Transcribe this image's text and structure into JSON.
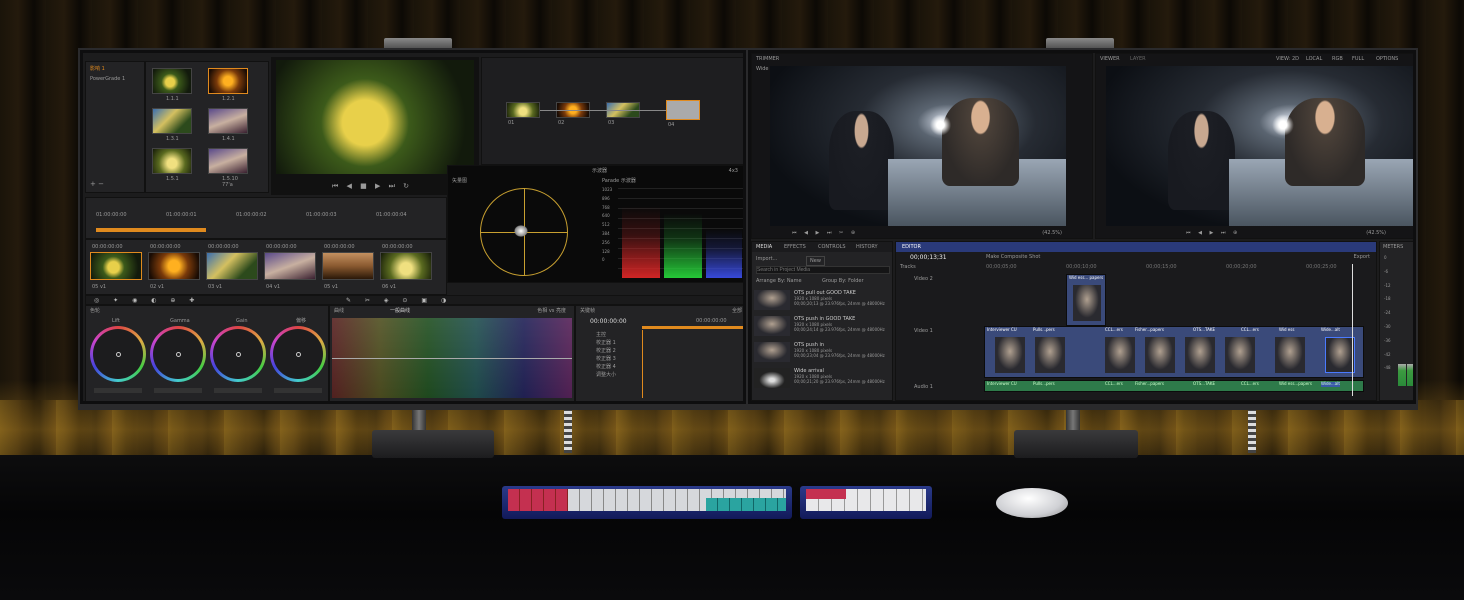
{
  "left_app": {
    "gallery": {
      "items": [
        {
          "label": "影响 1"
        },
        {
          "label": "PowerGrade 1"
        }
      ],
      "stills": [
        "1.1.1",
        "1.2.1",
        "1.3.1",
        "1.4.1",
        "1.5.1",
        "1.5.10\n77'a"
      ]
    },
    "timecodes": [
      "01:00:00:00",
      "01:00:00:01",
      "01:00:00:02",
      "01:00:00:03",
      "01:00:00:04"
    ],
    "clip_timecodes": [
      "00:00:00:00",
      "00:00:00:00",
      "00:00:00:00",
      "00:00:00:00",
      "00:00:00:00",
      "00:00:00:00"
    ],
    "clip_labels": [
      "05 v1",
      "02 v1",
      "03 v1",
      "04 v1",
      "05 v1",
      "06 v1"
    ],
    "nodes": [
      "01",
      "02",
      "03",
      "04"
    ],
    "scopes": {
      "title": "示波器",
      "vectorscope_label": "矢量图",
      "parade_label": "Parade 示波器",
      "zoom": "4x3",
      "levels": [
        "1023",
        "896",
        "768",
        "640",
        "512",
        "384",
        "256",
        "128",
        "0"
      ]
    },
    "color_panel": {
      "title": "色轮",
      "wheels": [
        {
          "name": "Lift"
        },
        {
          "name": "Gamma"
        },
        {
          "name": "Gain"
        },
        {
          "name": "偏移"
        }
      ],
      "curves_label": "曲线",
      "curves_mode": "一般曲线",
      "hue_label": "色相 vs 亮度",
      "keyframes_label": "关键帧",
      "keyframes_mode": "全部",
      "keyframe_time": "00:00:00:00",
      "keyframe_end": "00:00:00:00",
      "keyframe_tracks": [
        "主控",
        "校正器 1",
        "校正器 2",
        "校正器 3",
        "校正器 4",
        "调整大小"
      ]
    }
  },
  "right_app": {
    "panels": {
      "trimmer": "TRIMMER",
      "viewer": "VIEWER",
      "layer": "LAYER",
      "viewer_opts": [
        "VIEW: 2D",
        "LOCAL",
        "RGB",
        "FULL",
        "OPTIONS"
      ],
      "clip_name": "Wide papers alt",
      "zoom_left": "(42.5%)",
      "zoom_right": "(42.5%)"
    },
    "media": {
      "tabs": [
        "MEDIA",
        "EFFECTS",
        "CONTROLS",
        "HISTORY"
      ],
      "import_label": "Import...",
      "new_label": "New",
      "search_placeholder": "Search in Project Media",
      "arrange_label": "Arrange By: Name",
      "group_label": "Group By: Folder",
      "items": [
        {
          "name": "OTS pull out GOOD TAKE",
          "meta": "1920 x 1080 pixels\n00;00;20;13 @ 23.976fps, 24mm @ 48000Hz"
        },
        {
          "name": "OTS push in GOOD TAKE",
          "meta": "1920 x 1080 pixels\n00;00;24;14 @ 23.976fps, 24mm @ 48000Hz"
        },
        {
          "name": "OTS push in",
          "meta": "1920 x 1080 pixels\n00;00;23;04 @ 23.976fps, 24mm @ 48000Hz"
        },
        {
          "name": "Wide arrival",
          "meta": "1920 x 1080 pixels\n00;00;21;20 @ 23.976fps, 24mm @ 48000Hz"
        }
      ]
    },
    "editor": {
      "tab": "EDITOR",
      "timecode": "00;00;13;31",
      "composite_label": "Make Composite Shot",
      "export_label": "Export",
      "ruler": [
        "00;00;05;00",
        "00;00;10;00",
        "00;00;15;00",
        "00;00;20;00",
        "00;00;25;00"
      ],
      "tracks": [
        {
          "name": "Video 2"
        },
        {
          "name": "Video 1"
        },
        {
          "name": "Audio 1"
        }
      ],
      "v2_clips": [
        "Wid ess... papers"
      ],
      "v1_clips": [
        "Interviewer CU",
        "Pulls...pers",
        "CCL...ers",
        "Fisher...papers",
        "OTS...TAKE",
        "CCL...ers",
        "Wid ess",
        "Wide...alt"
      ],
      "a1_clips": [
        "Interviewer CU",
        "Pulls...pers",
        "CCL...ers",
        "Fisher...papers",
        "OTS...TAKE",
        "CCL...ers",
        "Wid ess...papers",
        "Wide...alt"
      ],
      "tracks_header": "Tracks"
    },
    "meters": {
      "title": "METERS",
      "scale": [
        "0",
        "-6",
        "-12",
        "-18",
        "-24",
        "-30",
        "-36",
        "-42",
        "-48"
      ]
    }
  },
  "colors": {
    "accent_orange": "#e08a1e",
    "accent_blue": "#3a5aa8",
    "audio_green": "#2e7a4a",
    "video_blue": "#3a4a7a"
  }
}
